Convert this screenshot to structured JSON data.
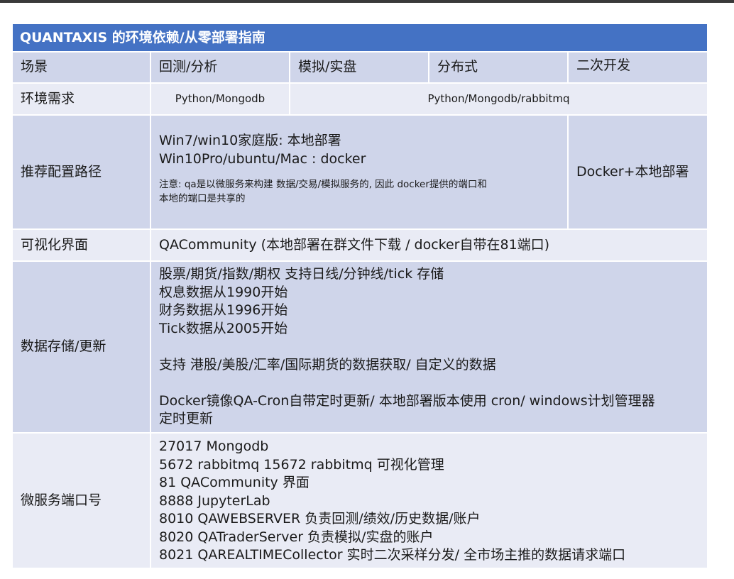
{
  "title": "QUANTAXIS 的环境依赖/从零部署指南",
  "header": {
    "label": "场景",
    "backtest": "回测/分析",
    "sim": "模拟/实盘",
    "dist": "分布式",
    "dev": "二次开发"
  },
  "env": {
    "label": "环境需求",
    "basic": "Python/Mongodb",
    "full": "Python/Mongodb/rabbitmq"
  },
  "config": {
    "label": "推荐配置路径",
    "lines": [
      "Win7/win10家庭版:  本地部署",
      "Win10Pro/ubuntu/Mac : docker"
    ],
    "note": [
      "注意: qa是以微服务来构建 数据/交易/模拟服务的, 因此 docker提供的端口和",
      "本地的端口是共享的"
    ],
    "right": "Docker+本地部署"
  },
  "visual": {
    "label": "可视化界面",
    "value": "QACommunity (本地部署在群文件下载 / docker自带在81端口)"
  },
  "storage": {
    "label": "数据存储/更新",
    "lines": [
      "股票/期货/指数/期权   支持日线/分钟线/tick 存储",
      "权息数据从1990开始",
      "财务数据从1996开始",
      "Tick数据从2005开始"
    ],
    "support": "支持 港股/美股/汇率/国际期货的数据获取/  自定义的数据",
    "cron": [
      "Docker镜像QA-Cron自带定时更新/  本地部署版本使用 cron/ windows计划管理器",
      "定时更新"
    ]
  },
  "ports": {
    "label": "微服务端口号",
    "lines": [
      "27017 Mongodb",
      "5672 rabbitmq     15672 rabbitmq 可视化管理",
      "81 QACommunity 界面",
      "8888 JupyterLab",
      "8010 QAWEBSERVER 负责回测/绩效/历史数据/账户",
      "8020 QATraderServer 负责模拟/实盘的账户",
      "8021 QAREALTIMECollector 实时二次采样分发/ 全市场主推的数据请求端口"
    ]
  },
  "colors": {
    "title_bg": "#4472c4",
    "row_dark": "#cfd5ea",
    "row_light": "#e9ebf5"
  }
}
